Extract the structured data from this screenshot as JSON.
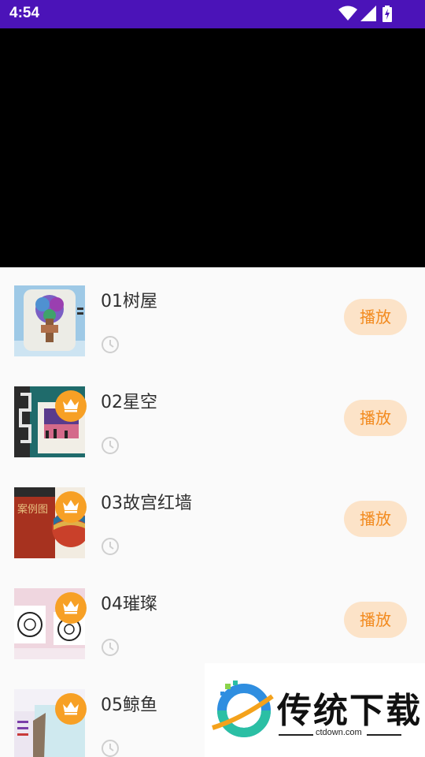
{
  "status_bar": {
    "time": "4:54",
    "icons": [
      "wifi-icon",
      "cell-signal-icon",
      "battery-charging-icon"
    ]
  },
  "video_player": {
    "background": "#000000"
  },
  "lessons": [
    {
      "title": "01树屋",
      "play_label": "播放",
      "vip": false,
      "thumb": "tree-house-painting"
    },
    {
      "title": "02星空",
      "play_label": "播放",
      "vip": true,
      "thumb": "starry-sky-painting"
    },
    {
      "title": "03故宫红墙",
      "play_label": "播放",
      "vip": true,
      "thumb": "forbidden-city-red-wall"
    },
    {
      "title": "04璀璨",
      "play_label": "播放",
      "vip": true,
      "thumb": "brilliant-sketch"
    },
    {
      "title": "05鲸鱼",
      "play_label": "播放",
      "vip": true,
      "thumb": "whale-painting"
    }
  ],
  "watermark": {
    "name": "传统下载",
    "url": "ctdown.com"
  },
  "colors": {
    "status_bar": "#4b13b8",
    "play_button_bg": "#fce3c8",
    "play_button_text": "#f28a1e",
    "vip_badge": "#f7a025"
  }
}
